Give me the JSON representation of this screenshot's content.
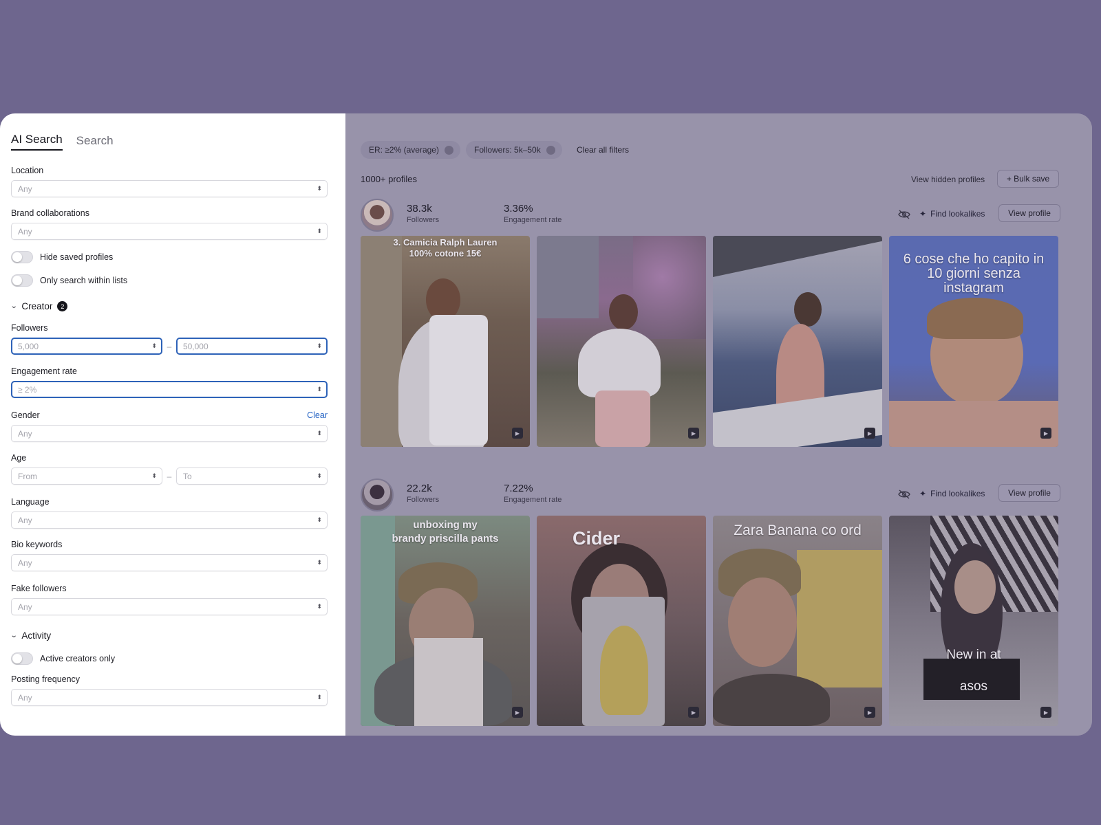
{
  "tabs": {
    "ai_search": "AI Search",
    "search": "Search"
  },
  "filters": {
    "location": {
      "label": "Location",
      "value": "Any"
    },
    "brand": {
      "label": "Brand collaborations",
      "value": "Any"
    },
    "hide_saved": "Hide saved profiles",
    "only_lists": "Only search within lists",
    "creator": {
      "title": "Creator",
      "badge": "2"
    },
    "followers": {
      "label": "Followers",
      "min": "5,000",
      "max": "50,000",
      "sep": "–"
    },
    "engagement": {
      "label": "Engagement rate",
      "value": "≥ 2%"
    },
    "gender": {
      "label": "Gender",
      "clear": "Clear",
      "value": "Any"
    },
    "age": {
      "label": "Age",
      "from": "From",
      "to": "To",
      "sep": "–"
    },
    "language": {
      "label": "Language",
      "value": "Any"
    },
    "bio": {
      "label": "Bio keywords",
      "value": "Any"
    },
    "fake": {
      "label": "Fake followers",
      "value": "Any"
    },
    "activity": {
      "title": "Activity"
    },
    "active_only": "Active creators only",
    "posting": {
      "label": "Posting frequency",
      "value": "Any"
    }
  },
  "toolbar": {
    "chip_er": "ER: ≥2% (average)",
    "chip_followers": "Followers: 5k–50k",
    "clear_all": "Clear all filters",
    "count": "1000+ profiles",
    "view_hidden": "View hidden profiles",
    "bulk_save": "+ Bulk save"
  },
  "profiles": [
    {
      "followers": "38.3k",
      "followers_label": "Followers",
      "er": "3.36%",
      "er_label": "Engagement rate",
      "find": "Find lookalikes",
      "view": "View profile",
      "posts": [
        {
          "caption": "3. Camicia Ralph Lauren\n100% cotone 15€"
        },
        {
          "caption": ""
        },
        {
          "caption": ""
        },
        {
          "caption": "6 cose che ho capito in\n10 giorni senza\ninstagram"
        }
      ]
    },
    {
      "followers": "22.2k",
      "followers_label": "Followers",
      "er": "7.22%",
      "er_label": "Engagement rate",
      "find": "Find lookalikes",
      "view": "View profile",
      "posts": [
        {
          "caption": "unboxing my\nbrandy priscilla pants"
        },
        {
          "caption": "Cider"
        },
        {
          "caption": "Zara Banana co ord"
        },
        {
          "caption": "New in at\nasos"
        }
      ]
    }
  ],
  "icons": {
    "video": "video-icon",
    "hide": "eye-off-icon",
    "sparkle": "sparkle-icon"
  }
}
